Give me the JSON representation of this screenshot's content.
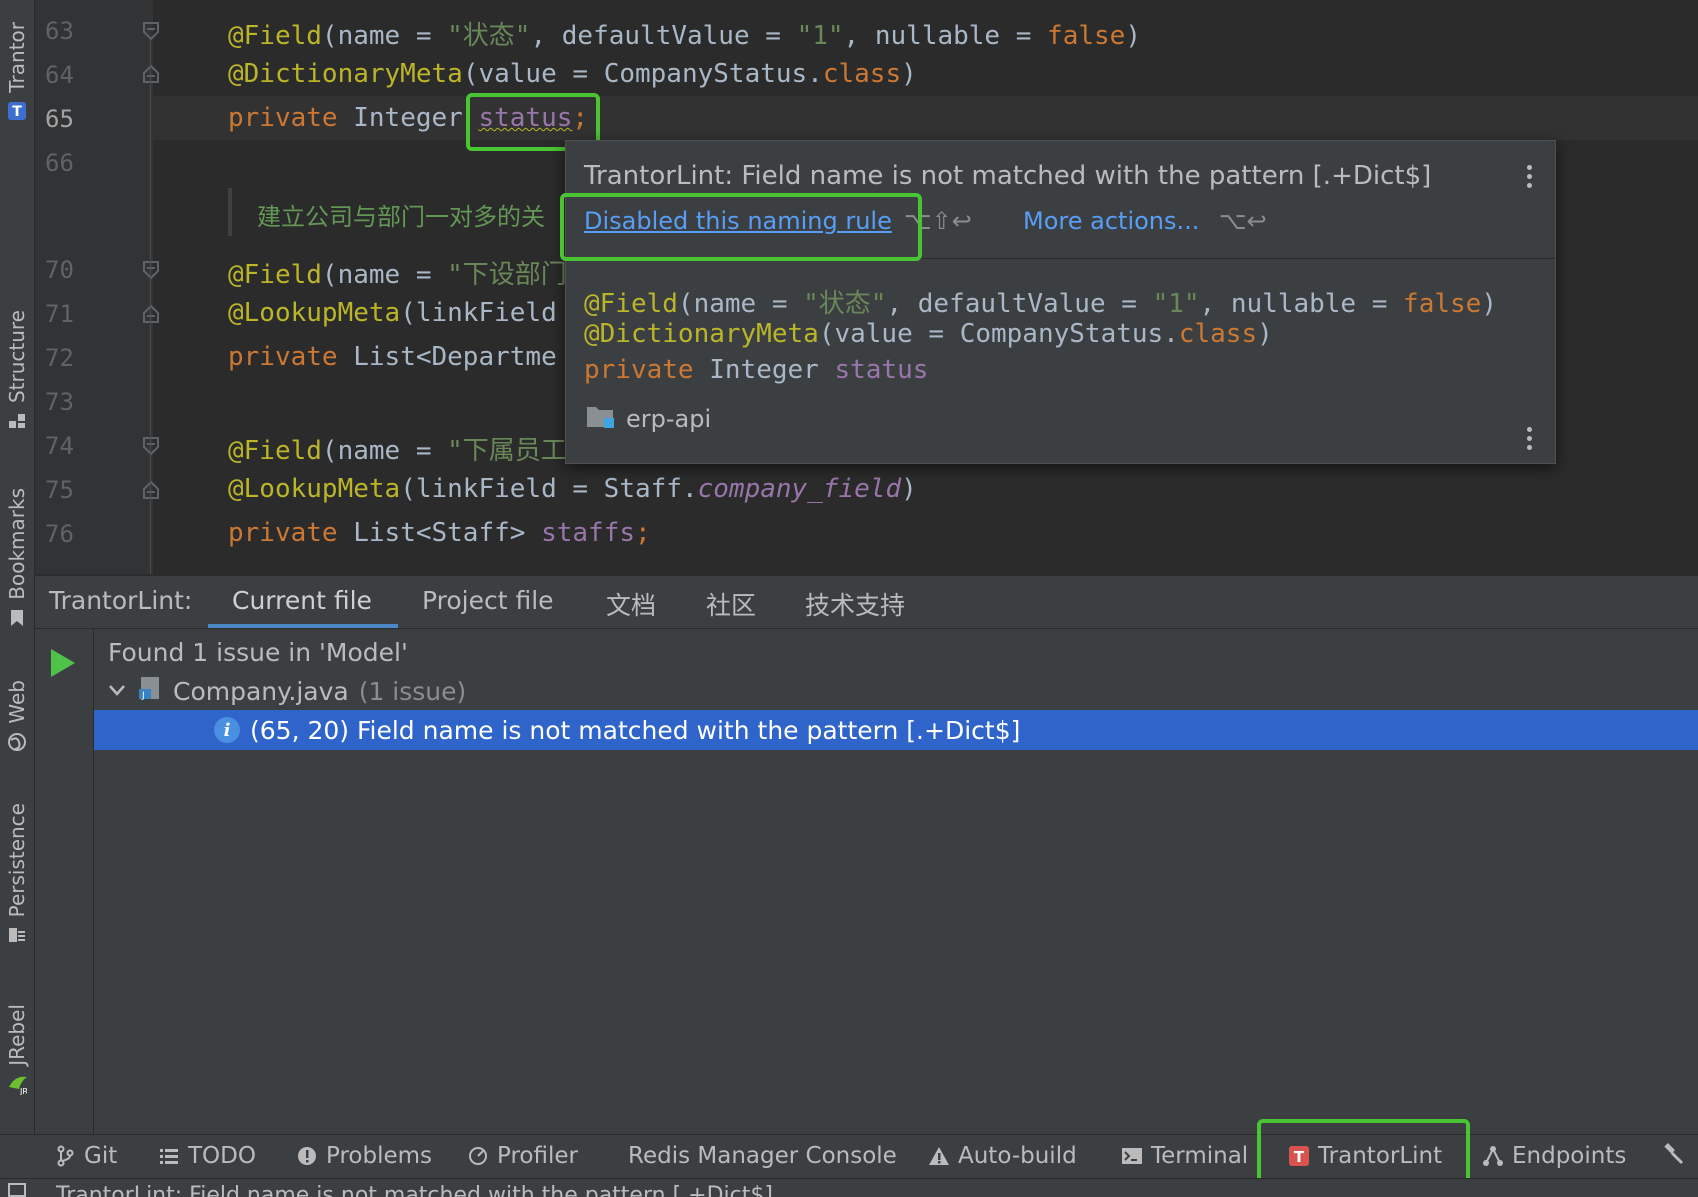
{
  "sidebar": {
    "tabs": [
      {
        "label": "Trantor",
        "icon": "trantor-t-icon"
      },
      {
        "label": "Structure",
        "icon": "structure-icon"
      },
      {
        "label": "Bookmarks",
        "icon": "bookmark-icon"
      },
      {
        "label": "Web",
        "icon": "globe-icon"
      },
      {
        "label": "Persistence",
        "icon": "persistence-icon"
      },
      {
        "label": "JRebel",
        "icon": "jrebel-icon"
      }
    ]
  },
  "editor": {
    "line_numbers": [
      "63",
      "64",
      "65",
      "66",
      "70",
      "71",
      "72",
      "73",
      "74",
      "75",
      "76"
    ],
    "lines": {
      "l63": {
        "ann": "@Field",
        "p1": "(name = ",
        "s1": "\"状态\"",
        "p2": ", defaultValue = ",
        "s2": "\"1\"",
        "p3": ", nullable = ",
        "k1": "false",
        "p4": ")"
      },
      "l64": {
        "ann": "@DictionaryMeta",
        "p1": "(value = CompanyStatus.",
        "k1": "class",
        "p2": ")"
      },
      "l65": {
        "k1": "private",
        "p1": " Integer ",
        "f1": "status",
        "k2": ";"
      },
      "l66": {
        "comment": "建立公司与部门一对多的关"
      },
      "l70": {
        "ann": "@Field",
        "p1": "(name = ",
        "s1": "\"下设部门"
      },
      "l71": {
        "ann": "@LookupMeta",
        "p1": "(linkField"
      },
      "l72": {
        "k1": "private",
        "p1": " List<Departme"
      },
      "l74": {
        "ann": "@Field",
        "p1": "(name = ",
        "s1": "\"下属员工"
      },
      "l75": {
        "ann": "@LookupMeta",
        "p1": "(linkField = Staff.",
        "f1": "company_field",
        "p2": ")"
      },
      "l76": {
        "k1": "private",
        "p1": " List<Staff> ",
        "f1": "staffs",
        "k2": ";"
      }
    }
  },
  "popup": {
    "title": "TrantorLint: Field name is not matched with the pattern [.+Dict$]",
    "disable_link": "Disabled this naming rule",
    "disable_shortcut": "⌥⇧↩",
    "more_actions": "More actions...",
    "more_shortcut": "⌥↩",
    "code": {
      "l1": {
        "ann": "@Field",
        "p1": "(name = ",
        "s1": "\"状态\"",
        "p2": ", defaultValue = ",
        "s2": "\"1\"",
        "p3": ", nullable = ",
        "k1": "false",
        "p4": ")"
      },
      "l2": {
        "ann": "@DictionaryMeta",
        "p1": "(value = CompanyStatus.",
        "k1": "class",
        "p2": ")"
      },
      "l3": {
        "k1": "private",
        "p1": " Integer ",
        "f1": "status"
      }
    },
    "module": "erp-api"
  },
  "toolwindow": {
    "name": "TrantorLint:",
    "tabs": [
      "Current file",
      "Project file",
      "文档",
      "社区",
      "技术支持"
    ],
    "active_tab": "Current file",
    "summary": "Found 1 issue in 'Model'",
    "file": {
      "name": "Company.java",
      "count": "(1 issue)"
    },
    "issue": "(65, 20) Field name is not matched with the pattern [.+Dict$]"
  },
  "bottom_bar": {
    "items": [
      {
        "label": "Git",
        "icon": "git-branch-icon"
      },
      {
        "label": "TODO",
        "icon": "list-icon"
      },
      {
        "label": "Problems",
        "icon": "problems-icon"
      },
      {
        "label": "Profiler",
        "icon": "profiler-icon"
      },
      {
        "label": "Redis Manager Console",
        "icon": ""
      },
      {
        "label": "Auto-build",
        "icon": "warning-icon"
      },
      {
        "label": "Terminal",
        "icon": "terminal-icon"
      },
      {
        "label": "TrantorLint",
        "icon": "trantor-t-icon"
      },
      {
        "label": "Endpoints",
        "icon": "endpoints-icon"
      }
    ]
  },
  "status_bar": {
    "text": "TrantorLint: Field name is not matched with the pattern [.+Dict$]"
  },
  "colors": {
    "highlight": "#49c533",
    "selection": "#2f65ca",
    "link": "#589df6",
    "annotation": "#bbb529",
    "keyword": "#cc7832",
    "string": "#6a8759",
    "field": "#9876aa"
  }
}
